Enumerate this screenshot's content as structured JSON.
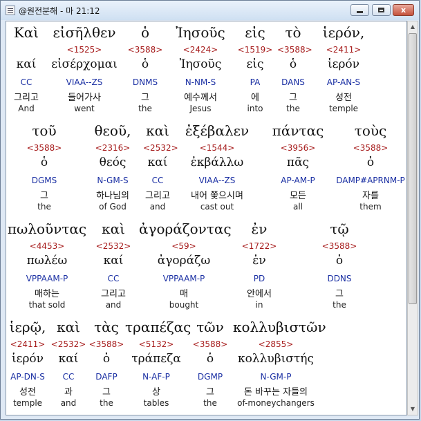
{
  "window": {
    "title": "@원전분해 - 마 21:12",
    "controls": {
      "minimize": "",
      "maximize": "",
      "close": "x"
    }
  },
  "verse": {
    "blocks": [
      {
        "words": [
          {
            "greek": "Καὶ",
            "strong": "",
            "lemma": "καί",
            "parsing": "CC",
            "korean": "그리고",
            "english": "And"
          },
          {
            "greek": "εἰσῆλθεν",
            "strong": "<1525>",
            "lemma": "εἰσέρχομαι",
            "parsing": "VIAA--ZS",
            "korean": "들어가사",
            "english": "went"
          },
          {
            "greek": "ὁ",
            "strong": "<3588>",
            "lemma": "ὁ",
            "parsing": "DNMS",
            "korean": "그",
            "english": "the"
          },
          {
            "greek": "Ἰησοῦς",
            "strong": "<2424>",
            "lemma": "Ἰησοῦς",
            "parsing": "N-NM-S",
            "korean": "예수께서",
            "english": "Jesus"
          },
          {
            "greek": "εἰς",
            "strong": "<1519>",
            "lemma": "εἰς",
            "parsing": "PA",
            "korean": "에",
            "english": "into"
          },
          {
            "greek": "τὸ",
            "strong": "<3588>",
            "lemma": "ὁ",
            "parsing": "DANS",
            "korean": "그",
            "english": "the"
          },
          {
            "greek": "ἱερόν,",
            "strong": "<2411>",
            "lemma": "ἱερόν",
            "parsing": "AP-AN-S",
            "korean": "성전",
            "english": "temple"
          }
        ]
      },
      {
        "words": [
          {
            "greek": "τοῦ",
            "strong": "<3588>",
            "lemma": "ὁ",
            "parsing": "DGMS",
            "korean": "그",
            "english": "the"
          },
          {
            "greek": "θεοῦ,",
            "strong": "<2316>",
            "lemma": "θεός",
            "parsing": "N-GM-S",
            "korean": "하나님의",
            "english": "of God"
          },
          {
            "greek": "καὶ",
            "strong": "<2532>",
            "lemma": "καί",
            "parsing": "CC",
            "korean": "그리고",
            "english": "and"
          },
          {
            "greek": "ἐξέβαλεν",
            "strong": "<1544>",
            "lemma": "ἐκβάλλω",
            "parsing": "VIAA--ZS",
            "korean": "내어 쫓으시며",
            "english": "cast out"
          },
          {
            "greek": "πάντας",
            "strong": "<3956>",
            "lemma": "πᾶς",
            "parsing": "AP-AM-P",
            "korean": "모든",
            "english": "all"
          },
          {
            "greek": "τοὺς",
            "strong": "<3588>",
            "lemma": "ὁ",
            "parsing": "DAMP#APRNM-P",
            "korean": "자를",
            "english": "them"
          }
        ]
      },
      {
        "words": [
          {
            "greek": "πωλοῦντας",
            "strong": "<4453>",
            "lemma": "πωλέω",
            "parsing": "VPPAAM-P",
            "korean": "매하는",
            "english": "that sold"
          },
          {
            "greek": "καὶ",
            "strong": "<2532>",
            "lemma": "καί",
            "parsing": "CC",
            "korean": "그리고",
            "english": "and"
          },
          {
            "greek": "ἀγοράζοντας",
            "strong": "<59>",
            "lemma": "ἀγοράζω",
            "parsing": "VPPAAM-P",
            "korean": "매",
            "english": "bought"
          },
          {
            "greek": "ἐν",
            "strong": "<1722>",
            "lemma": "ἐν",
            "parsing": "PD",
            "korean": "안에서",
            "english": "in"
          },
          {
            "greek": "τῷ",
            "strong": "<3588>",
            "lemma": "ὁ",
            "parsing": "DDNS",
            "korean": "그",
            "english": "the"
          }
        ]
      },
      {
        "words": [
          {
            "greek": "ἱερῷ,",
            "strong": "<2411>",
            "lemma": "ἱερόν",
            "parsing": "AP-DN-S",
            "korean": "성전",
            "english": "temple"
          },
          {
            "greek": "καὶ",
            "strong": "<2532>",
            "lemma": "καί",
            "parsing": "CC",
            "korean": "과",
            "english": "and"
          },
          {
            "greek": "τὰς",
            "strong": "<3588>",
            "lemma": "ὁ",
            "parsing": "DAFP",
            "korean": "그",
            "english": "the"
          },
          {
            "greek": "τραπέζας",
            "strong": "<5132>",
            "lemma": "τράπεζα",
            "parsing": "N-AF-P",
            "korean": "상",
            "english": "tables"
          },
          {
            "greek": "τῶν",
            "strong": "<3588>",
            "lemma": "ὁ",
            "parsing": "DGMP",
            "korean": "그",
            "english": "the"
          },
          {
            "greek": "κολλυβιστῶν",
            "strong": "<2855>",
            "lemma": "κολλυβιστής",
            "parsing": "N-GM-P",
            "korean": "돈 바꾸는 자들의",
            "english": "of-moneychangers"
          }
        ]
      }
    ]
  }
}
